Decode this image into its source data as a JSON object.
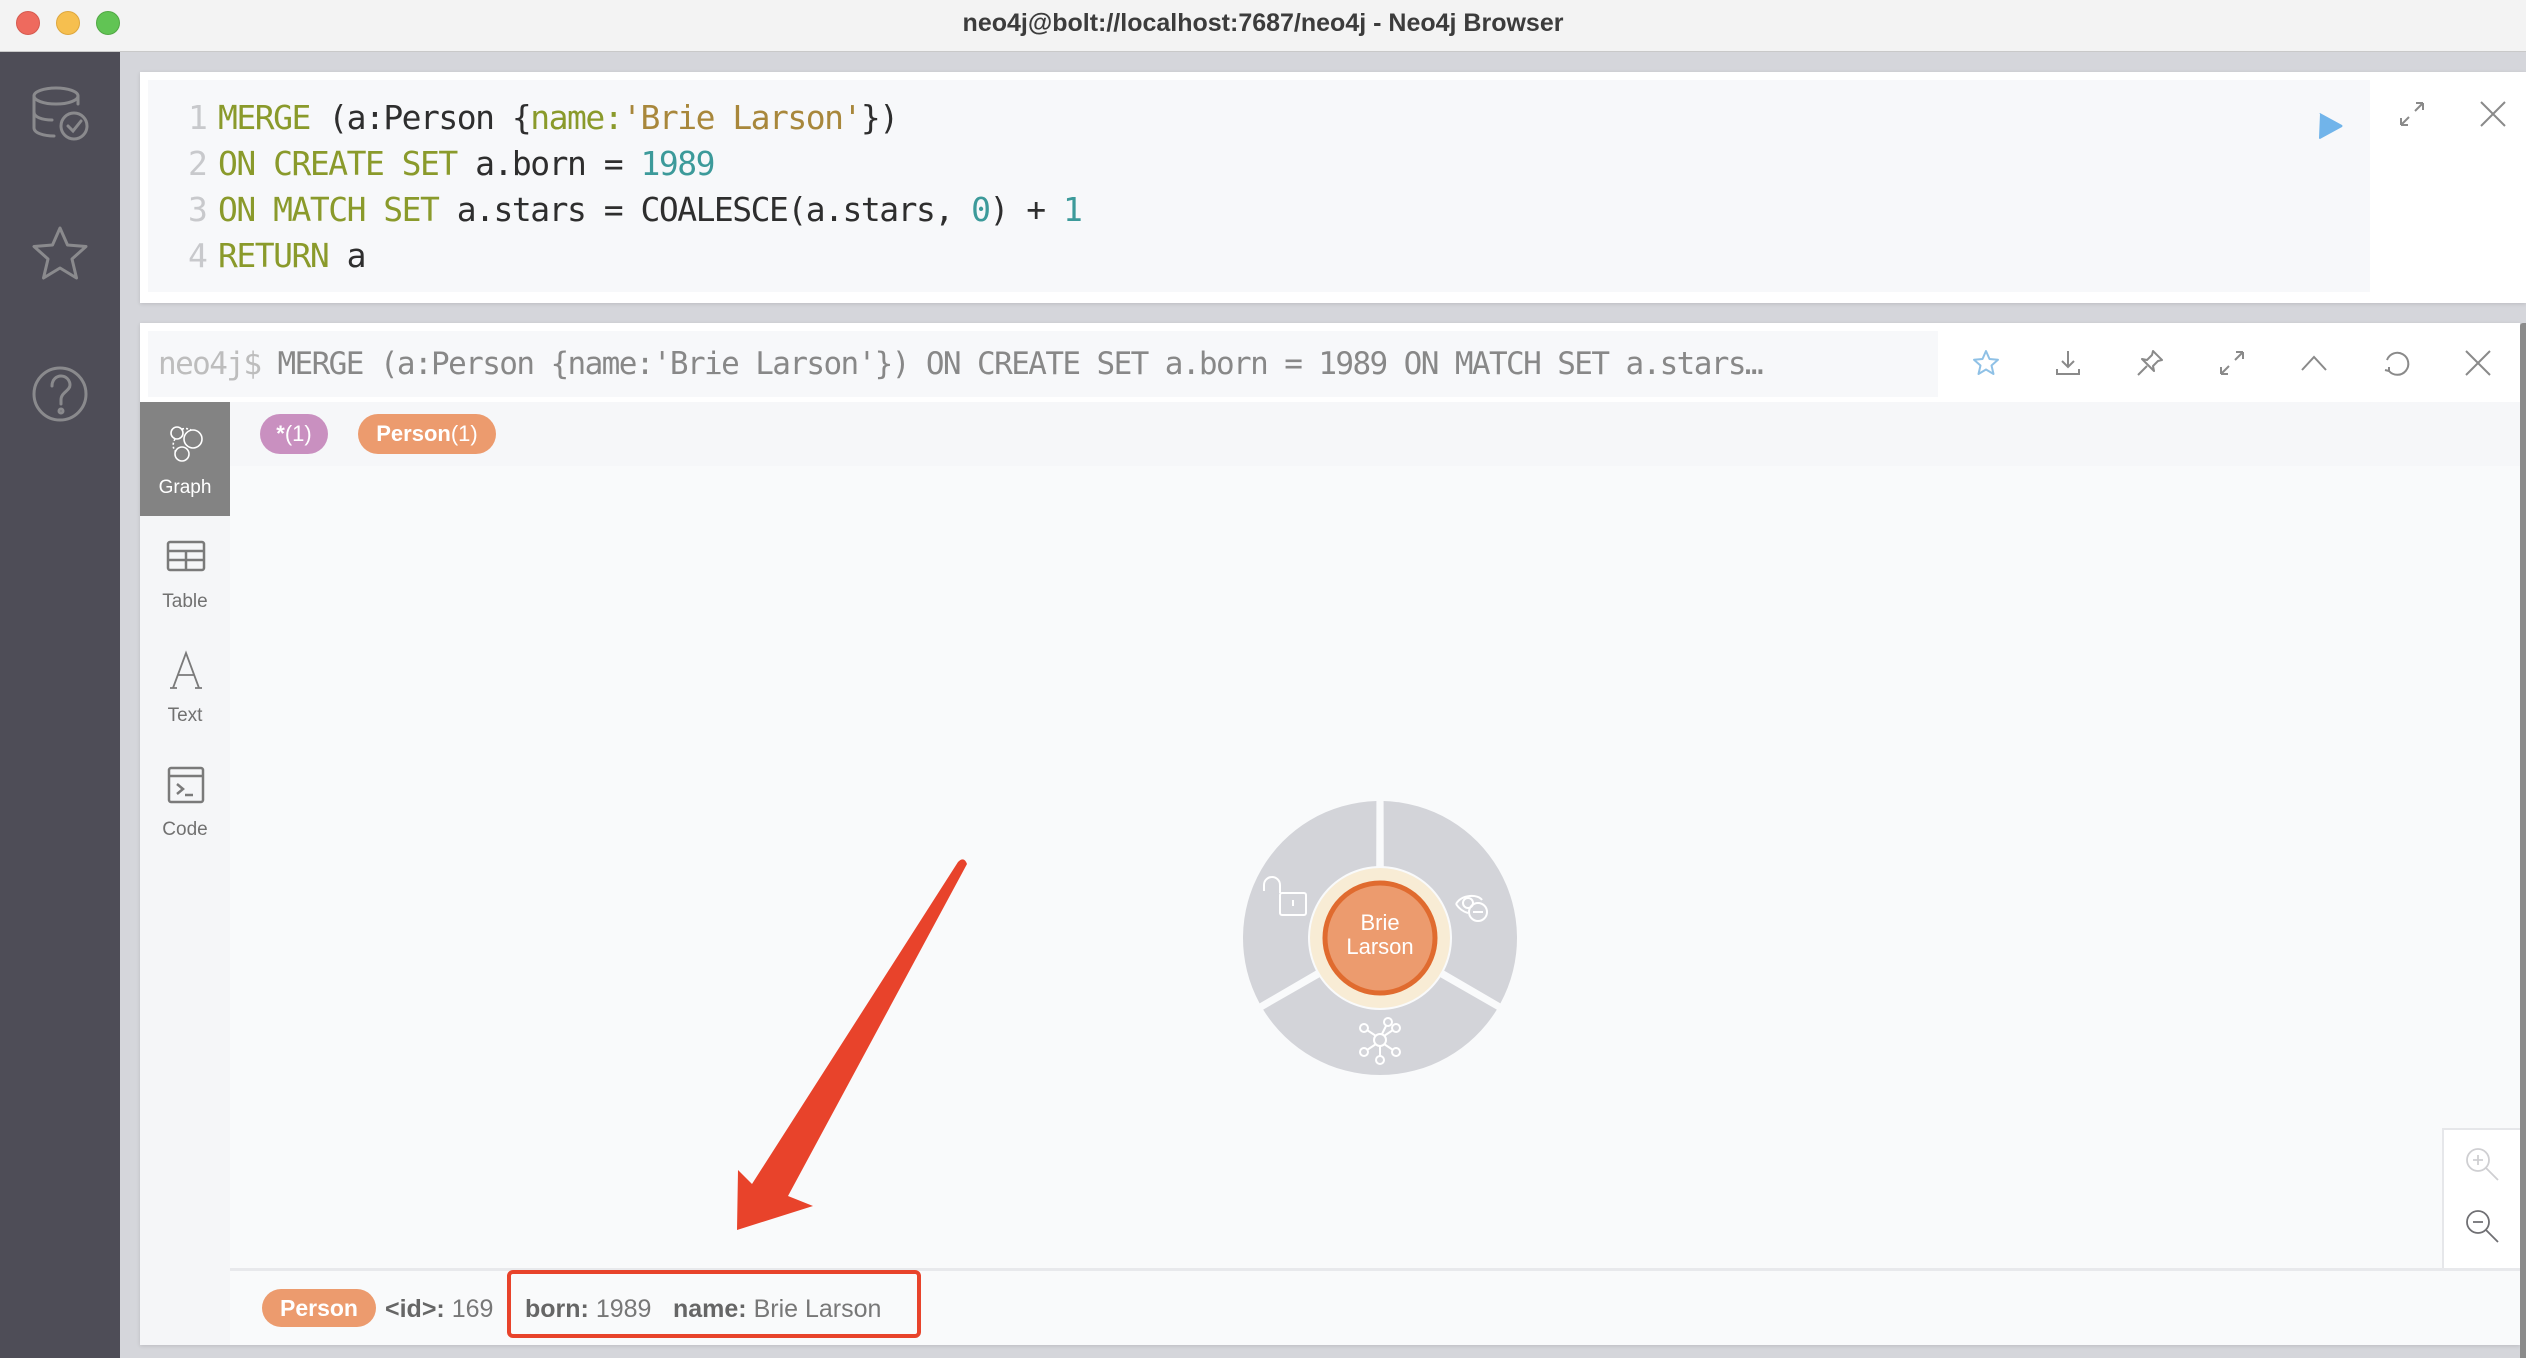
{
  "window": {
    "title": "neo4j@bolt://localhost:7687/neo4j - Neo4j Browser"
  },
  "sidebar": {
    "items": [
      {
        "icon": "database-check-icon"
      },
      {
        "icon": "star-icon"
      },
      {
        "icon": "help-icon"
      }
    ]
  },
  "editor": {
    "lines": [
      {
        "num": "1",
        "tokens": [
          {
            "t": "MERGE",
            "c": "kw"
          },
          {
            "t": " (a:Person {",
            "c": ""
          },
          {
            "t": "name:",
            "c": "kw"
          },
          {
            "t": "'Brie Larson'",
            "c": "str"
          },
          {
            "t": "})",
            "c": ""
          }
        ]
      },
      {
        "num": "2",
        "tokens": [
          {
            "t": "ON CREATE SET",
            "c": "kw"
          },
          {
            "t": " a.born = ",
            "c": ""
          },
          {
            "t": "1989",
            "c": "num"
          }
        ]
      },
      {
        "num": "3",
        "tokens": [
          {
            "t": "ON MATCH SET",
            "c": "kw"
          },
          {
            "t": " a.stars = COALESCE(a.stars, ",
            "c": ""
          },
          {
            "t": "0",
            "c": "num"
          },
          {
            "t": ") + ",
            "c": ""
          },
          {
            "t": "1",
            "c": "num"
          }
        ]
      },
      {
        "num": "4",
        "tokens": [
          {
            "t": "RETURN",
            "c": "kw"
          },
          {
            "t": " a",
            "c": ""
          }
        ]
      }
    ],
    "buttons": {
      "run": "play-icon",
      "expand": "expand-icon",
      "close": "close-icon"
    }
  },
  "result": {
    "prompt": "neo4j$",
    "query": " MERGE (a:Person {name:'Brie Larson'}) ON CREATE SET a.born = 1989 ON MATCH SET a.stars…",
    "toolbar": [
      "star-icon",
      "download-icon",
      "pin-icon",
      "expand-icon",
      "collapse-icon",
      "rerun-icon",
      "close-icon"
    ],
    "view_tabs": [
      {
        "label": "Graph",
        "active": true
      },
      {
        "label": "Table",
        "active": false
      },
      {
        "label": "Text",
        "active": false
      },
      {
        "label": "Code",
        "active": false
      }
    ],
    "labels": [
      {
        "name": "*",
        "count": "(1)",
        "color": "#c990c0"
      },
      {
        "name": "Person",
        "count": "(1)",
        "color": "#ec9b6e"
      }
    ],
    "node": {
      "caption_line1": "Brie",
      "caption_line2": "Larson",
      "fill": "#ec9b6e",
      "stroke": "#e06b2f",
      "halo": "#f8ecd5",
      "menu_color": "#d3d4d9",
      "menu_actions": [
        "unlock-icon",
        "hide-icon",
        "expand-relationships-icon"
      ]
    },
    "zoom_controls": [
      "zoom-in-icon",
      "zoom-out-icon"
    ],
    "status": {
      "label": "Person",
      "props": [
        {
          "key": "<id>:",
          "value": "169"
        },
        {
          "key": "born:",
          "value": "1989"
        },
        {
          "key": "name:",
          "value": "Brie Larson"
        }
      ]
    }
  },
  "annotation": {
    "color": "#e8432b"
  }
}
